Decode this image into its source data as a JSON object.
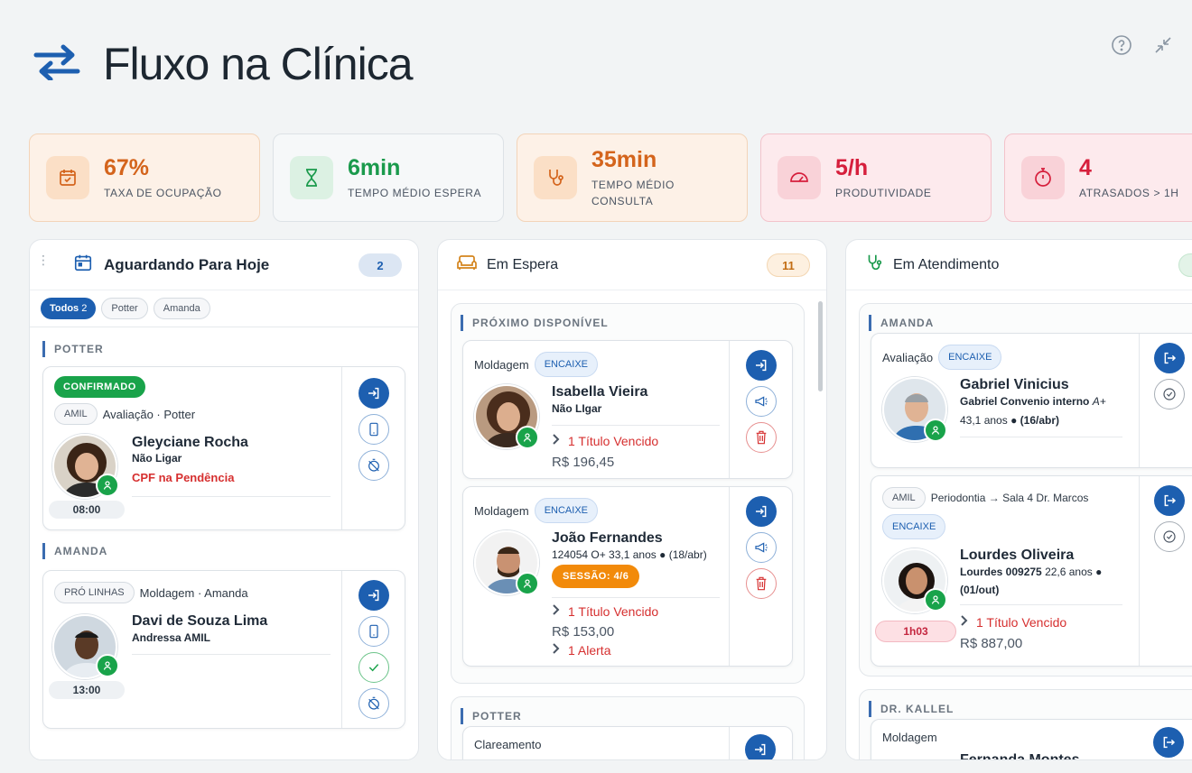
{
  "header": {
    "title": "Fluxo na Clínica",
    "icon": "swap-arrows-icon"
  },
  "top_icons": [
    "help-icon",
    "minimize-icon"
  ],
  "kpis": [
    {
      "value": "67%",
      "label": "TAXA DE OCUPAÇÃO",
      "color": "#d4641c",
      "bg": "#fdf0e6",
      "icon": "calendar-check-icon"
    },
    {
      "value": "6min",
      "label": "TEMPO MÉDIO ESPERA",
      "color": "#1a9a4c",
      "bg": "#f7f9fa",
      "icon": "hourglass-icon"
    },
    {
      "value": "35min",
      "label1": "TEMPO MÉDIO",
      "label2": "CONSULTA",
      "color": "#d4641c",
      "bg": "#fdf0e6",
      "icon": "stethoscope-icon"
    },
    {
      "value": "5/h",
      "label": "PRODUTIVIDADE",
      "color": "#d61f3c",
      "bg": "#fde9ec",
      "icon": "speedometer-icon"
    },
    {
      "value": "4",
      "label": "ATRASADOS > 1H",
      "color": "#d61f3c",
      "bg": "#fde9ec",
      "icon": "stopwatch-icon"
    }
  ],
  "col1": {
    "title": "Aguardando Para Hoje",
    "count": "2",
    "filters": [
      {
        "label": "Todos",
        "count": "2"
      },
      {
        "label": "Potter"
      },
      {
        "label": "Amanda"
      }
    ],
    "sec1": "POTTER",
    "card1": {
      "status": "CONFIRMADO",
      "tag": "AMIL",
      "desc": "Avaliação · Potter",
      "name": "Gleyciane Rocha",
      "sub": "Não Ligar",
      "alert": "CPF na Pendência",
      "time": "08:00"
    },
    "sec2": "AMANDA",
    "card2": {
      "tag": "PRÓ LINHAS",
      "desc": "Moldagem · Amanda",
      "name": "Davi de Souza Lima",
      "sub": "Andressa AMIL",
      "time": "13:00"
    }
  },
  "col2": {
    "title": "Em Espera",
    "count": "11",
    "sec1": "PRÓXIMO DISPONÍVEL",
    "card1": {
      "proc": "Moldagem",
      "tag": "ENCAIXE",
      "name": "Isabella Vieira",
      "sub": "Não LIgar",
      "alert": "1 Título Vencido",
      "money": "R$ 196,45"
    },
    "card2": {
      "proc": "Moldagem",
      "tag": "ENCAIXE",
      "name": "João Fernandes",
      "sub": "124054 O+ 33,1 anos",
      "sub_date": "(18/abr)",
      "session": "SESSÃO: 4/6",
      "alert": "1 Título Vencido",
      "money": "R$ 153,00",
      "alert2": "1 Alerta"
    },
    "sec2": "POTTER",
    "card3": {
      "proc": "Clareamento"
    }
  },
  "col3": {
    "title": "Em Atendimento",
    "sec1": "AMANDA",
    "card1": {
      "proc": "Avaliação",
      "tag": "ENCAIXE",
      "name": "Gabriel Vinicius",
      "sub": "Gabriel Convenio interno",
      "blood": "A+",
      "age": "43,1 anos",
      "date": "(16/abr)"
    },
    "card2": {
      "tag": "AMIL",
      "desc": "Periodontia → Sala 4 Dr. Marcos",
      "tag2": "ENCAIXE",
      "name": "Lourdes Oliveira",
      "sub": "Lourdes 009275",
      "age": "22,6 anos",
      "date": "(01/out)",
      "time": "1h03",
      "alert": "1 Título Vencido",
      "money": "R$ 887,00"
    },
    "sec2": "DR. KALLEL",
    "card3": {
      "proc": "Moldagem",
      "name": "Fernanda Montes"
    }
  }
}
